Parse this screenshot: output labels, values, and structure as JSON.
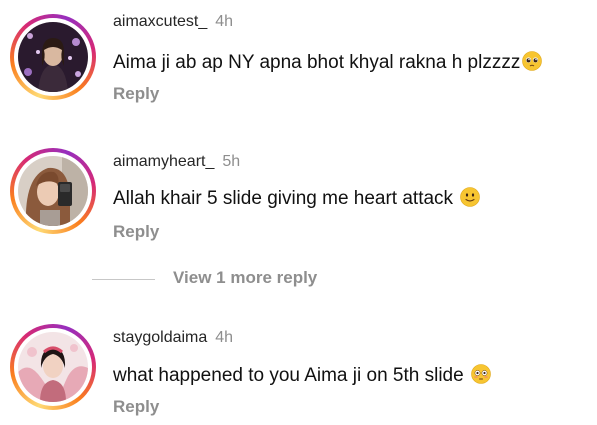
{
  "comments": [
    {
      "username": "aimaxcutest_",
      "time": "4h",
      "text": "Aima ji ab ap NY apna bhot khyal rakna h plzzzz",
      "emoji": "pleading-face",
      "reply_label": "Reply"
    },
    {
      "username": "aimamyheart_",
      "time": "5h",
      "text": "Allah khair 5 slide giving me heart attack ",
      "emoji": "slightly-smiling-face",
      "reply_label": "Reply"
    },
    {
      "username": "staygoldaima",
      "time": "4h",
      "text": "what happened to you Aima ji on 5th slide ",
      "emoji": "flushed-face",
      "reply_label": "Reply"
    }
  ],
  "view_more": {
    "label": "View 1 more reply"
  },
  "colors": {
    "username": "#262626",
    "secondary": "#8e8e8e",
    "text": "#111111",
    "ring_start": "#feda75",
    "ring_mid": "#d62976",
    "ring_end": "#962fbf",
    "emoji_yellow": "#f7c531"
  }
}
